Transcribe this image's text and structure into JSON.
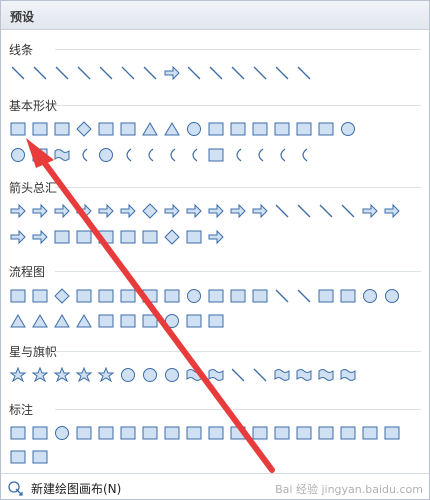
{
  "panel": {
    "title": "预设",
    "new_canvas_label": "新建绘图画布(N)",
    "watermark": "Bai 经验 jingyan.baidu.com"
  },
  "colors": {
    "shape_fill": "#cfe0f3",
    "shape_stroke": "#3c6da8",
    "annotation_arrow": "#e83c3c"
  },
  "sections": [
    {
      "title": "线条",
      "rows": [
        [
          "line",
          "arrow",
          "double-arrow",
          "curve",
          "freeform",
          "scribble",
          "elbow-connector",
          "elbow-arrow",
          "elbow-double-arrow",
          "zigzag",
          "zigzag-arrow",
          "curved-connector",
          "curved-arrow",
          "curved-double-arrow"
        ]
      ]
    },
    {
      "title": "基本形状",
      "rows": [
        [
          "rectangle",
          "parallelogram",
          "trapezoid",
          "diamond",
          "rounded-rectangle",
          "octagon",
          "triangle",
          "right-triangle",
          "oval",
          "hexagon",
          "pentagon",
          "can",
          "cube",
          "frame",
          "folded-corner",
          "smiley"
        ],
        [
          "no-symbol",
          "lightning",
          "heart",
          "moon-tool",
          "sun",
          "moon",
          "arc",
          "bracket-pair",
          "brace-pair",
          "plaque",
          "left-bracket",
          "right-bracket",
          "left-brace",
          "right-brace"
        ]
      ]
    },
    {
      "title": "箭头总汇",
      "rows": [
        [
          "right-arrow",
          "left-arrow",
          "up-arrow",
          "down-arrow",
          "left-right-arrow",
          "up-down-arrow",
          "quad-arrow",
          "left-right-up-arrow",
          "bent-arrow",
          "u-turn-arrow",
          "left-up-arrow",
          "bent-up-arrow",
          "curved-right-arrow",
          "curved-left-arrow",
          "curved-up-arrow",
          "curved-down-arrow",
          "striped-right-arrow",
          "notched-right-arrow"
        ],
        [
          "pentagon-arrow",
          "chevron",
          "right-callout",
          "down-callout",
          "left-callout",
          "up-callout",
          "left-right-callout",
          "quad-callout",
          "up-down-callout",
          "circular-arrow"
        ]
      ]
    },
    {
      "title": "流程图",
      "rows": [
        [
          "process",
          "alternate-process",
          "decision",
          "data",
          "predefined",
          "internal-storage",
          "document",
          "multidocument",
          "terminator",
          "preparation",
          "manual-input",
          "manual-operation",
          "connector",
          "offpage-connector",
          "card",
          "punched-tape",
          "summing-junction",
          "or"
        ],
        [
          "collate",
          "sort",
          "extract",
          "merge",
          "stored-data",
          "delay",
          "sequential-storage",
          "magnetic-disk",
          "direct-storage",
          "display"
        ]
      ]
    },
    {
      "title": "星与旗帜",
      "rows": [
        [
          "explosion-1",
          "explosion-2",
          "star-4",
          "star-5",
          "star-8",
          "star-16",
          "star-24",
          "star-32",
          "up-ribbon",
          "down-ribbon",
          "curved-up-ribbon",
          "curved-down-ribbon",
          "vertical-scroll",
          "horizontal-scroll",
          "wave",
          "double-wave"
        ]
      ]
    },
    {
      "title": "标注",
      "rows": [
        [
          "rect-callout",
          "rounded-callout",
          "oval-callout",
          "cloud-callout",
          "line-callout-1",
          "line-callout-2",
          "line-callout-3",
          "line-callout-4",
          "accent-callout-1",
          "accent-callout-2",
          "accent-callout-3",
          "accent-callout-4",
          "border-callout-1",
          "border-callout-2",
          "border-callout-3",
          "border-callout-4",
          "accent-border-callout-1",
          "accent-border-callout-2"
        ],
        [
          "accent-border-callout-3",
          "accent-border-callout-4"
        ]
      ]
    }
  ]
}
